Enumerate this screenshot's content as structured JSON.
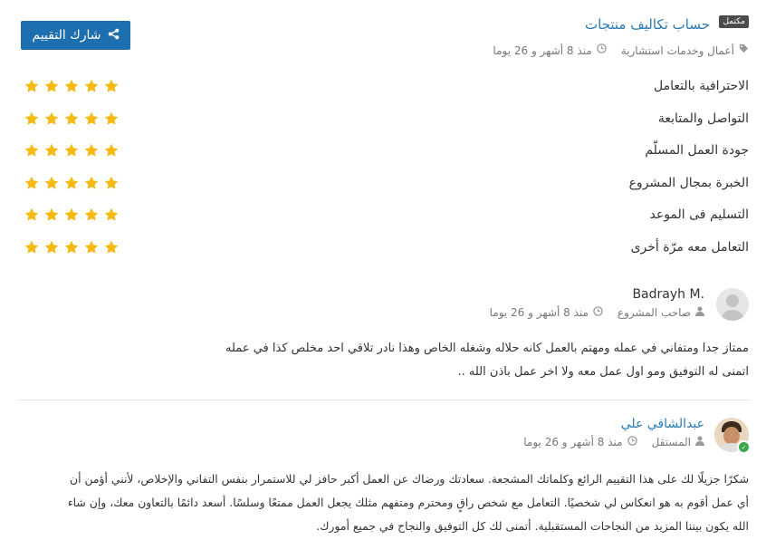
{
  "project": {
    "badge": "مكتمل",
    "title": "حساب تكاليف منتجات",
    "category": "أعمال وخدمات استشارية",
    "time_ago": "منذ 8 أشهر و 26 يوما"
  },
  "share_button": {
    "label": "شارك التقييم",
    "icon": "share-icon"
  },
  "ratings": [
    {
      "label": "الاحترافية بالتعامل",
      "stars": 5
    },
    {
      "label": "التواصل والمتابعة",
      "stars": 5
    },
    {
      "label": "جودة العمل المسلّم",
      "stars": 5
    },
    {
      "label": "الخبرة بمجال المشروع",
      "stars": 5
    },
    {
      "label": "التسليم فى الموعد",
      "stars": 5
    },
    {
      "label": "التعامل معه مرّة أخرى",
      "stars": 5
    }
  ],
  "owner_review": {
    "name": "Badrayh M.",
    "role": "صاحب المشروع",
    "time_ago": "منذ 8 أشهر و 26 يوما",
    "text_line1": "ممتاز جدا ومتفاني في عمله ومهتم بالعمل كانه حلاله وشغله الخاص وهذا نادر تلاقي احد مخلص كذا في عمله",
    "text_line2": "اتمنى له التوفيق ومو اول عمل معه ولا اخر عمل باذن الله .."
  },
  "freelancer_reply": {
    "name": "عبدالشافي علي",
    "role": "المستقل",
    "time_ago": "منذ 8 أشهر و 26 يوما",
    "text_line1": "شكرًا جزيلًا لك على هذا التقييم الرائع وكلماتك المشجعة. سعادتك ورضاك عن العمل أكبر حافز لي للاستمرار بنفس التفاني والإخلاص، لأنني أؤمن أن",
    "text_line2": "أي عمل أقوم به هو انعكاس لي شخصيًا. التعامل مع شخص راقٍ ومحترم ومتفهم مثلك يجعل العمل ممتعًا وسلسًا. أسعد دائمًا بالتعاون معك، وإن شاء",
    "text_line3": "الله يكون بيننا المزيد من النجاحات المستقبلية. أتمنى لك كل التوفيق والنجاح في جميع أمورك."
  },
  "colors": {
    "link": "#2a7ab0",
    "button": "#1e6fb0",
    "star": "#f5b90f",
    "online": "#3aa74d"
  }
}
